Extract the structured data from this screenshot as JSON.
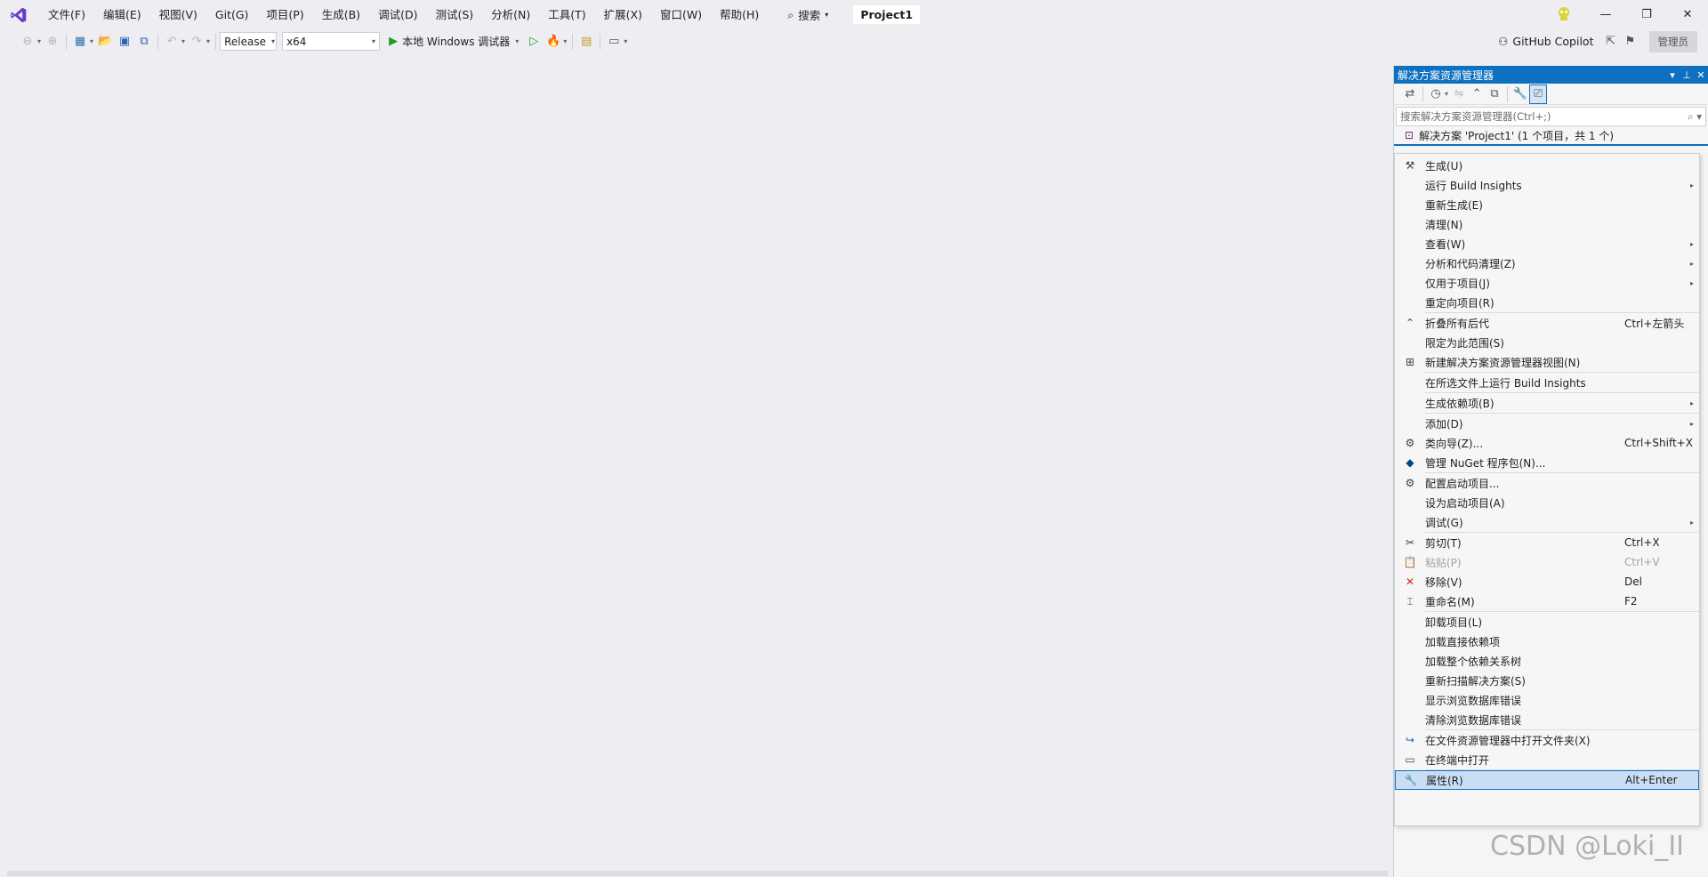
{
  "titlebar": {
    "menu": [
      "文件(F)",
      "编辑(E)",
      "视图(V)",
      "Git(G)",
      "项目(P)",
      "生成(B)",
      "调试(D)",
      "测试(S)",
      "分析(N)",
      "工具(T)",
      "扩展(X)",
      "窗口(W)",
      "帮助(H)"
    ],
    "search_label": "搜索",
    "project_name": "Project1",
    "window_controls": [
      "—",
      "❐",
      "✕"
    ]
  },
  "toolbar": {
    "config": "Release",
    "platform": "x64",
    "run_label": "本地 Windows 调试器",
    "copilot_label": "GitHub Copilot",
    "admin_label": "管理员"
  },
  "solution_explorer": {
    "title": "解决方案资源管理器",
    "search_placeholder": "搜索解决方案资源管理器(Ctrl+;)",
    "root_label": "解决方案 'Project1' (1 个项目，共 1 个)"
  },
  "context_menu": {
    "items": [
      {
        "label": "生成(U)",
        "shortcut": "",
        "icon": "build-icon",
        "submenu": false
      },
      {
        "label": "运行 Build Insights",
        "shortcut": "",
        "icon": "",
        "submenu": true
      },
      {
        "label": "重新生成(E)",
        "shortcut": "",
        "icon": "",
        "submenu": false
      },
      {
        "label": "清理(N)",
        "shortcut": "",
        "icon": "",
        "submenu": false
      },
      {
        "label": "查看(W)",
        "shortcut": "",
        "icon": "",
        "submenu": true
      },
      {
        "label": "分析和代码清理(Z)",
        "shortcut": "",
        "icon": "",
        "submenu": true
      },
      {
        "label": "仅用于项目(J)",
        "shortcut": "",
        "icon": "",
        "submenu": true
      },
      {
        "label": "重定向项目(R)",
        "shortcut": "",
        "icon": "",
        "submenu": false
      },
      {
        "sep": true
      },
      {
        "label": "折叠所有后代",
        "shortcut": "Ctrl+左箭头",
        "icon": "collapse-icon",
        "submenu": false
      },
      {
        "label": "限定为此范围(S)",
        "shortcut": "",
        "icon": "",
        "submenu": false
      },
      {
        "label": "新建解决方案资源管理器视图(N)",
        "shortcut": "",
        "icon": "new-view-icon",
        "submenu": false
      },
      {
        "sep": true
      },
      {
        "label": "在所选文件上运行 Build Insights",
        "shortcut": "",
        "icon": "",
        "submenu": false
      },
      {
        "sep": true
      },
      {
        "label": "生成依赖项(B)",
        "shortcut": "",
        "icon": "",
        "submenu": true
      },
      {
        "sep": true
      },
      {
        "label": "添加(D)",
        "shortcut": "",
        "icon": "",
        "submenu": true
      },
      {
        "label": "类向导(Z)...",
        "shortcut": "Ctrl+Shift+X",
        "icon": "class-wizard-icon",
        "submenu": false
      },
      {
        "label": "管理 NuGet 程序包(N)...",
        "shortcut": "",
        "icon": "nuget-icon",
        "submenu": false
      },
      {
        "sep": true
      },
      {
        "label": "配置启动项目...",
        "shortcut": "",
        "icon": "gear-icon",
        "submenu": false
      },
      {
        "label": "设为启动项目(A)",
        "shortcut": "",
        "icon": "",
        "submenu": false
      },
      {
        "label": "调试(G)",
        "shortcut": "",
        "icon": "",
        "submenu": true
      },
      {
        "sep": true
      },
      {
        "label": "剪切(T)",
        "shortcut": "Ctrl+X",
        "icon": "cut-icon",
        "submenu": false
      },
      {
        "label": "粘贴(P)",
        "shortcut": "Ctrl+V",
        "icon": "paste-icon",
        "submenu": false,
        "disabled": true
      },
      {
        "label": "移除(V)",
        "shortcut": "Del",
        "icon": "remove-icon",
        "submenu": false
      },
      {
        "label": "重命名(M)",
        "shortcut": "F2",
        "icon": "rename-icon",
        "submenu": false
      },
      {
        "sep": true
      },
      {
        "label": "卸载项目(L)",
        "shortcut": "",
        "icon": "",
        "submenu": false
      },
      {
        "label": "加载直接依赖项",
        "shortcut": "",
        "icon": "",
        "submenu": false
      },
      {
        "label": "加载整个依赖关系树",
        "shortcut": "",
        "icon": "",
        "submenu": false
      },
      {
        "label": "重新扫描解决方案(S)",
        "shortcut": "",
        "icon": "",
        "submenu": false
      },
      {
        "label": "显示浏览数据库错误",
        "shortcut": "",
        "icon": "",
        "submenu": false
      },
      {
        "label": "清除浏览数据库错误",
        "shortcut": "",
        "icon": "",
        "submenu": false
      },
      {
        "sep": true
      },
      {
        "label": "在文件资源管理器中打开文件夹(X)",
        "shortcut": "",
        "icon": "open-folder-icon",
        "submenu": false
      },
      {
        "label": "在终端中打开",
        "shortcut": "",
        "icon": "terminal-icon",
        "submenu": false
      },
      {
        "sep": true
      },
      {
        "label": "属性(R)",
        "shortcut": "Alt+Enter",
        "icon": "wrench-icon",
        "submenu": false,
        "selected": true
      }
    ]
  },
  "watermark": "CSDN @Loki_II"
}
